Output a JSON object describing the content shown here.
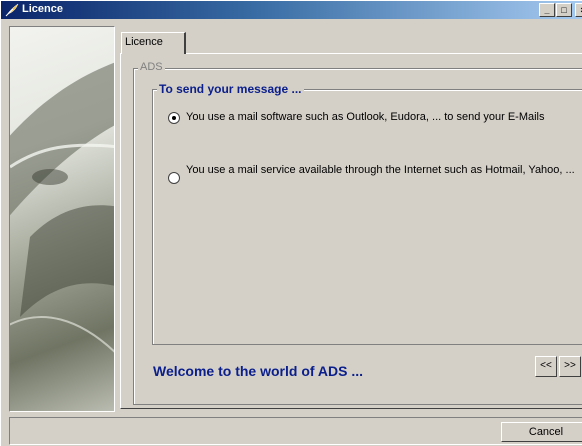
{
  "window": {
    "title": "Licence",
    "minimize_glyph": "_",
    "maximize_glyph": "□",
    "close_glyph": "×"
  },
  "tab": {
    "label": "Licence"
  },
  "ads_group": {
    "label": "ADS"
  },
  "message_group": {
    "label": "To send your message ...",
    "options": [
      {
        "label": "You use a mail software such as Outlook, Eudora, ... to send your E-Mails",
        "selected": true
      },
      {
        "label": "You use a mail service available through the Internet such as Hotmail, Yahoo, ...",
        "selected": false
      }
    ]
  },
  "welcome": {
    "text": "Welcome to the world of ADS ..."
  },
  "nav": {
    "prev_label": "<<",
    "next_label": ">>"
  },
  "footer": {
    "cancel_label": "Cancel"
  },
  "colors": {
    "title_blue": "#0a246a",
    "label_blue": "#0a1e8c",
    "face": "#d4d0c8"
  },
  "icons": {
    "title": "feather-icon"
  }
}
